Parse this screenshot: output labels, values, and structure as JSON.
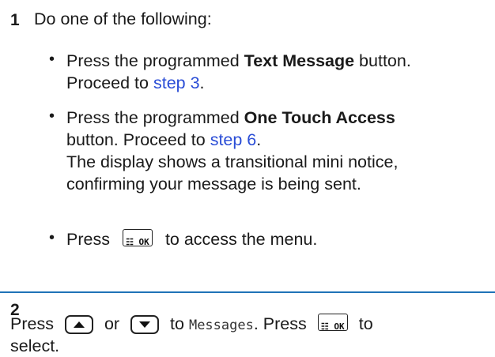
{
  "step1": {
    "number": "1",
    "intro": "Do one of the following:",
    "bullet_char": "•",
    "item1": {
      "line1_pre": "Press the programmed ",
      "line1_bold": "Text Message",
      "line1_post": " button.",
      "line2_pre": "Proceed to ",
      "line2_link": "step 3",
      "line2_post": "."
    },
    "item2": {
      "line1_pre": "Press the programmed ",
      "line1_bold": "One Touch Access",
      "line2_pre": "button. Proceed to ",
      "line2_link": "step 6",
      "line2_post": ".",
      "line3": "The display shows a transitional mini notice,",
      "line4": "confirming your message is being sent."
    },
    "item3": {
      "pre": "Press",
      "key_label": "☷ OK",
      "post": "to access the menu."
    }
  },
  "step2": {
    "number": "2",
    "pre": "Press",
    "or_text": "or",
    "to_text": "to",
    "menu_item": "Messages",
    "press_text": ". Press",
    "key_label": "☷ OK",
    "to_text2": "to",
    "line2": "select.",
    "icons": [
      "up-arrow-icon",
      "down-arrow-icon",
      "menu-ok-icon"
    ]
  },
  "colors": {
    "link": "#2a4dd6",
    "rule": "#1f73b7"
  }
}
